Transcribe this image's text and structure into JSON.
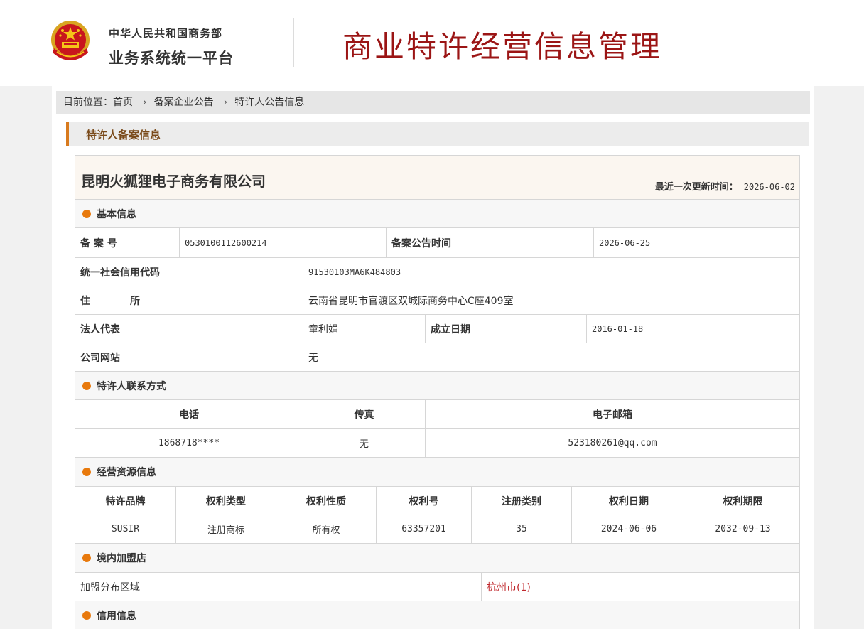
{
  "header": {
    "org_line1": "中华人民共和国商务部",
    "org_line2": "业务系统统一平台",
    "site_title": "商业特许经营信息管理"
  },
  "breadcrumb": {
    "prefix": "目前位置：",
    "items": [
      "首页",
      "备案企业公告",
      "特许人公告信息"
    ]
  },
  "section_title": "特许人备案信息",
  "company": {
    "name": "昆明火狐狸电子商务有限公司",
    "updated_label": "最近一次更新时间：",
    "updated_value": "2026-06-02"
  },
  "basic_info": {
    "heading": "基本信息",
    "record_no_label": "备 案 号",
    "record_no": "053010011260021​4",
    "announce_time_label": "备案公告时间",
    "announce_time": "2026-06-25",
    "credit_code_label": "统一社会信用代码",
    "credit_code": "91530103MA6K484803",
    "address_label": "住　　　　所",
    "address": "云南省昆明市官渡区双城际商务中心C座409室",
    "legal_rep_label": "法人代表",
    "legal_rep": "童利娟",
    "founded_label": "成立日期",
    "founded": "2016-01-18",
    "website_label": "公司网站",
    "website": "无"
  },
  "contact": {
    "heading": "特许人联系方式",
    "headers": [
      "电话",
      "传真",
      "电子邮箱"
    ],
    "phone": "1868718****",
    "fax": "无",
    "email": "523180261@qq.com"
  },
  "resources": {
    "heading": "经营资源信息",
    "headers": [
      "特许品牌",
      "权利类型",
      "权利性质",
      "权利号",
      "注册类别",
      "权利日期",
      "权利期限"
    ],
    "row": [
      "SUSIR",
      "注册商标",
      "所有权",
      "63357201",
      "35",
      "2024-06-06",
      "2032-09-13"
    ]
  },
  "domestic_stores": {
    "heading": "境内加盟店",
    "region_label": "加盟分布区域",
    "region_link": "杭州市(1)"
  },
  "credit": {
    "heading": "信用信息"
  },
  "colors": {
    "title_red": "#9b1515",
    "accent_orange": "#e8790c",
    "link_red": "#c0282d"
  }
}
